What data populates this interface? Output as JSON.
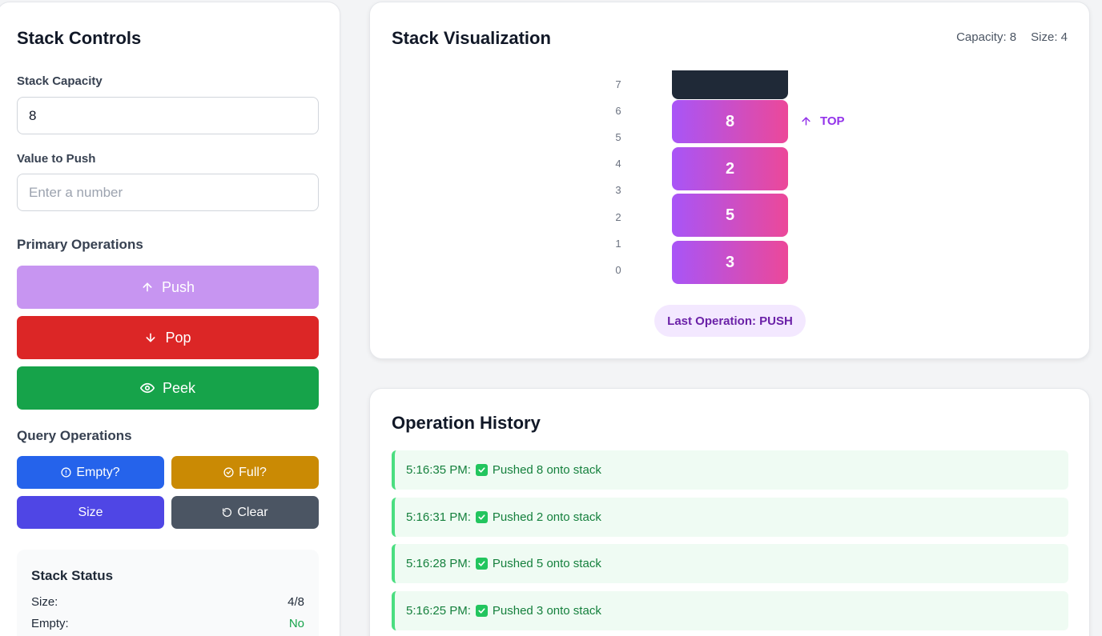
{
  "controls": {
    "title": "Stack Controls",
    "capacity_label": "Stack Capacity",
    "capacity_value": "8",
    "push_value_label": "Value to Push",
    "push_value_placeholder": "Enter a number",
    "primary_label": "Primary Operations",
    "push_label": "Push",
    "pop_label": "Pop",
    "peek_label": "Peek",
    "query_label": "Query Operations",
    "empty_label": "Empty?",
    "full_label": "Full?",
    "size_label": "Size",
    "clear_label": "Clear",
    "colors": {
      "push": "#c795f1",
      "pop": "#dc2626",
      "peek": "#16a34a",
      "empty": "#2563eb",
      "full": "#ca8a04",
      "size": "#4f46e5",
      "clear": "#4b5563"
    },
    "icons": {
      "push": "arrow-up-icon",
      "pop": "arrow-down-icon",
      "peek": "eye-icon",
      "empty": "info-circle-icon",
      "full": "check-circle-icon",
      "clear": "rotate-ccw-icon"
    }
  },
  "status": {
    "title": "Stack Status",
    "size_label": "Size:",
    "size_value": "4/8",
    "empty_label": "Empty:",
    "empty_value": "No"
  },
  "visualization": {
    "title": "Stack Visualization",
    "capacity_text": "Capacity: 8",
    "size_text": "Size: 4",
    "indices": [
      "7",
      "6",
      "5",
      "4",
      "3",
      "2",
      "1",
      "0"
    ],
    "items": [
      "8",
      "2",
      "5",
      "3"
    ],
    "top_label": "TOP",
    "last_operation": "Last Operation: PUSH",
    "gradient": [
      "#a855f7",
      "#ec4899"
    ]
  },
  "history": {
    "title": "Operation History",
    "entries": [
      {
        "time": "5:16:35 PM:",
        "message": "Pushed 8 onto stack"
      },
      {
        "time": "5:16:31 PM:",
        "message": "Pushed 2 onto stack"
      },
      {
        "time": "5:16:28 PM:",
        "message": "Pushed 5 onto stack"
      },
      {
        "time": "5:16:25 PM:",
        "message": "Pushed 3 onto stack"
      }
    ]
  }
}
